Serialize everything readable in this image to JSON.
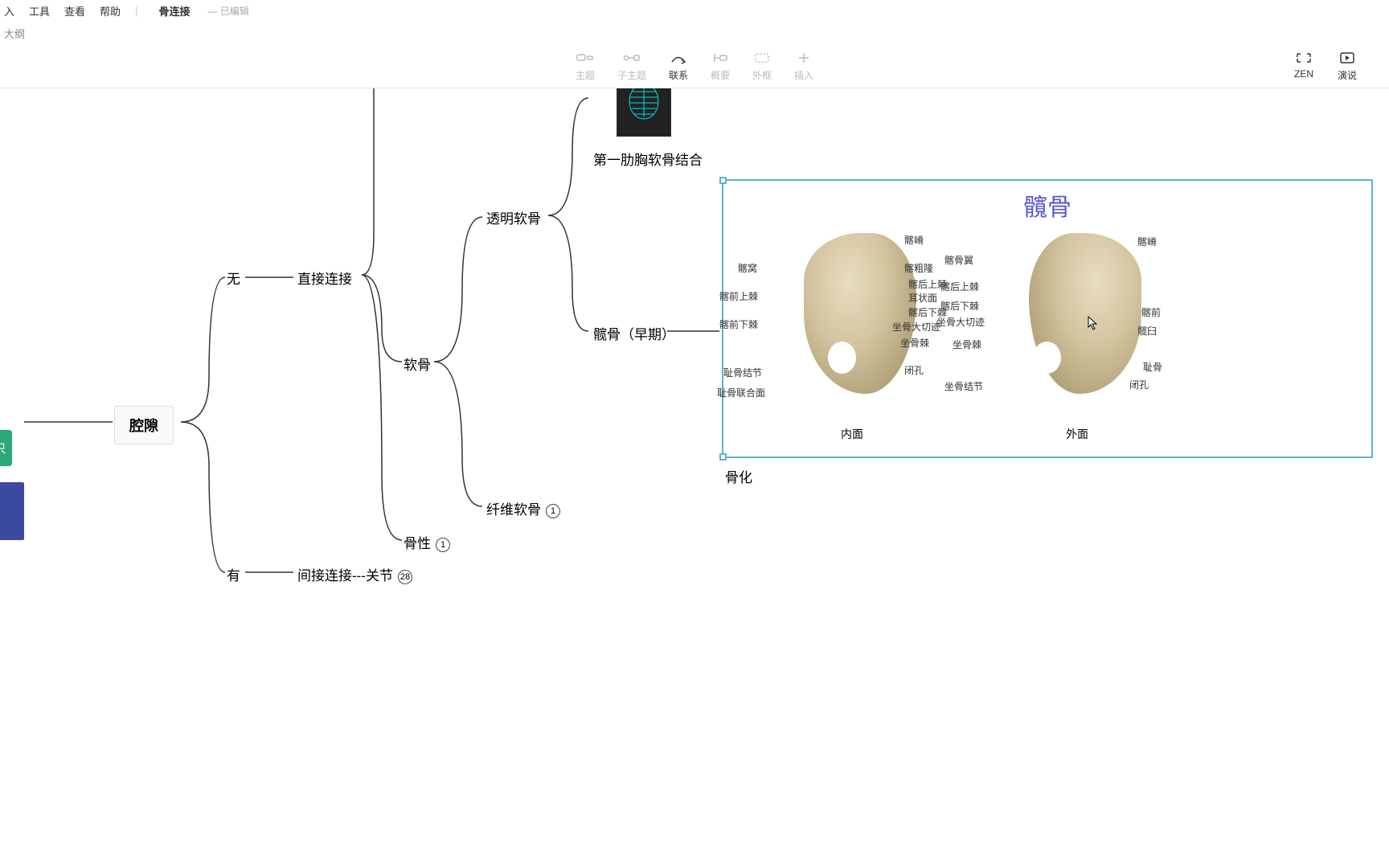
{
  "menubar": {
    "items": [
      "入",
      "工具",
      "查看",
      "帮助"
    ],
    "doc_title": "骨连接",
    "doc_status": "— 已编辑"
  },
  "tabbar": {
    "tab1": "大纲"
  },
  "toolbar": {
    "center": [
      {
        "label": "主题",
        "icon": "topic"
      },
      {
        "label": "子主题",
        "icon": "subtopic"
      },
      {
        "label": "联系",
        "icon": "relation",
        "active": true
      },
      {
        "label": "概要",
        "icon": "summary"
      },
      {
        "label": "外框",
        "icon": "boundary"
      },
      {
        "label": "插入",
        "icon": "insert"
      }
    ],
    "right": [
      {
        "label": "ZEN",
        "icon": "zen"
      },
      {
        "label": "演说",
        "icon": "pitch"
      }
    ]
  },
  "nodes": {
    "green_left": "只",
    "cavity": "腔隙",
    "none": "无",
    "direct": "直接连接",
    "cartilage": "软骨",
    "hyaline": "透明软骨",
    "fibro": "纤维软骨",
    "bony": "骨性",
    "yes": "有",
    "indirect": "间接连接---关节",
    "rib1": "第一肋胸软骨结合",
    "hip_early": "髋骨（早期）",
    "ossify": "骨化",
    "badge1": "1",
    "badge1b": "1",
    "badge28": "28"
  },
  "hip_diagram": {
    "title": "髖骨",
    "left_view": "内面",
    "right_view": "外面",
    "left_labels": [
      "髂窝",
      "髂前上棘",
      "髂前下棘",
      "耻骨结节",
      "耻骨联合面",
      "髂嵴",
      "髂粗隆",
      "髂后上棘",
      "耳状面",
      "髂后下棘",
      "坐骨大切迹",
      "坐骨棘",
      "闭孔"
    ],
    "right_labels": [
      "髂骨翼",
      "髂后上棘",
      "髂后下棘",
      "坐骨大切迹",
      "坐骨棘",
      "坐骨结节",
      "髂嵴",
      "髂前",
      "髋臼",
      "耻骨",
      "闭孔"
    ]
  }
}
